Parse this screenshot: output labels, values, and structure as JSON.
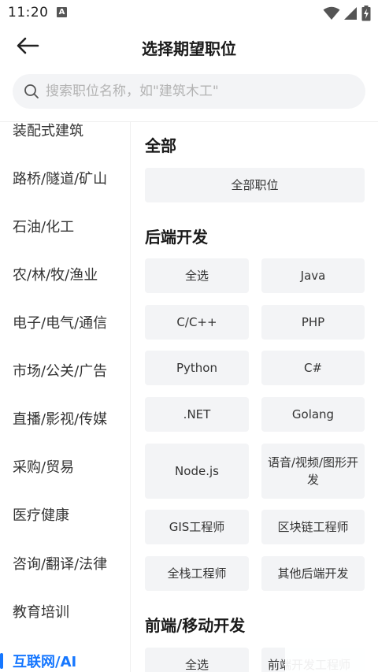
{
  "status": {
    "time": "11:20",
    "notification_letter": "A"
  },
  "header": {
    "title": "选择期望职位"
  },
  "search": {
    "placeholder": "搜索职位名称，如\"建筑木工\""
  },
  "sidebar": {
    "items": [
      {
        "label": "装配式建筑"
      },
      {
        "label": "路桥/隧道/矿山"
      },
      {
        "label": "石油/化工"
      },
      {
        "label": "农/林/牧/渔业"
      },
      {
        "label": "电子/电气/通信"
      },
      {
        "label": "市场/公关/广告"
      },
      {
        "label": "直播/影视/传媒"
      },
      {
        "label": "采购/贸易"
      },
      {
        "label": "医疗健康"
      },
      {
        "label": "咨询/翻译/法律"
      },
      {
        "label": "教育培训"
      },
      {
        "label": "互联网/AI"
      }
    ],
    "active_label": "互联网/AI"
  },
  "sections": {
    "all": {
      "title": "全部",
      "chips": [
        "全部职位"
      ]
    },
    "backend": {
      "title": "后端开发",
      "chips": [
        "全选",
        "Java",
        "C/C++",
        "PHP",
        "Python",
        "C#",
        ".NET",
        "Golang",
        "Node.js",
        "语音/视频/图形开发",
        "GIS工程师",
        "区块链工程师",
        "全栈工程师",
        "其他后端开发"
      ]
    },
    "frontend": {
      "title": "前端/移动开发",
      "chips": [
        "全选",
        "前端开发工程师"
      ]
    }
  },
  "colors": {
    "accent": "#1677ff",
    "chip_bg": "#f3f4f6",
    "search_bg": "#f3f4f6"
  }
}
